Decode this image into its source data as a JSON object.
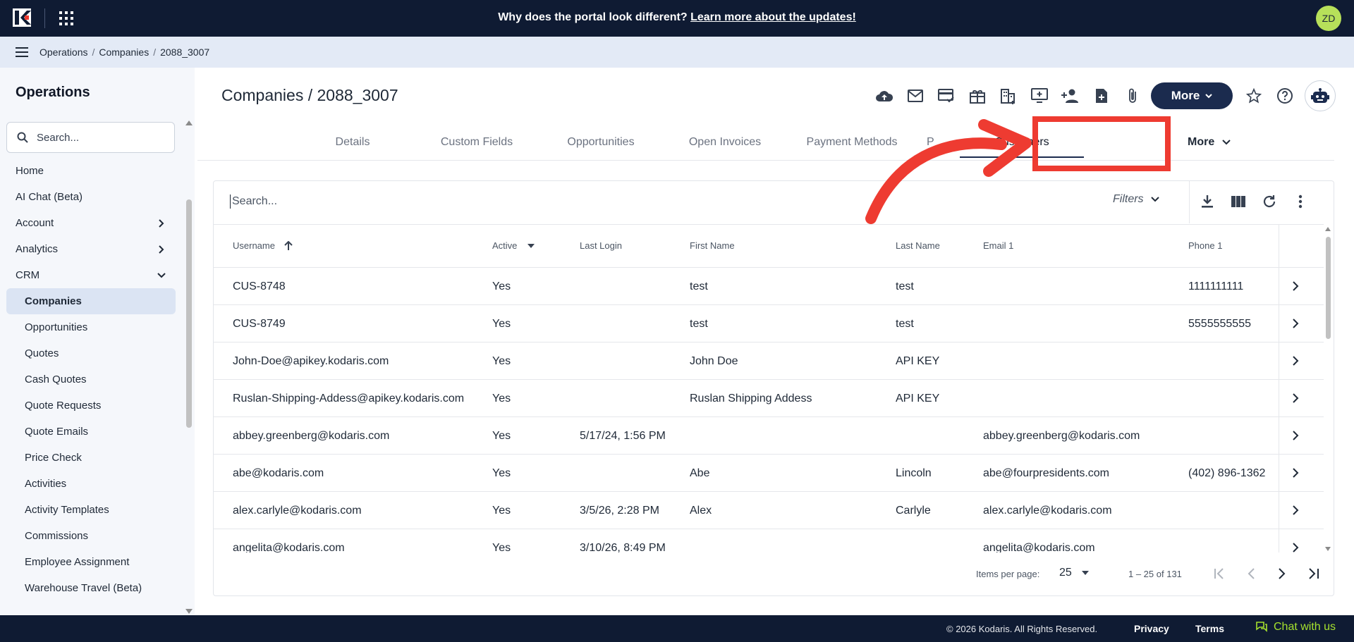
{
  "banner": {
    "text": "Why does the portal look different? ",
    "link": "Learn more about the updates!"
  },
  "user": {
    "initials": "ZD"
  },
  "breadcrumb": [
    "Operations",
    "Companies",
    "2088_3007"
  ],
  "sidebar": {
    "title": "Operations",
    "search_placeholder": "Search...",
    "items": [
      {
        "label": "Home",
        "type": "top"
      },
      {
        "label": "AI Chat (Beta)",
        "type": "top"
      },
      {
        "label": "Account",
        "type": "top",
        "chevron": "right"
      },
      {
        "label": "Analytics",
        "type": "top",
        "chevron": "right"
      },
      {
        "label": "CRM",
        "type": "top",
        "chevron": "down"
      },
      {
        "label": "Companies",
        "type": "sub",
        "active": true
      },
      {
        "label": "Opportunities",
        "type": "sub"
      },
      {
        "label": "Quotes",
        "type": "sub"
      },
      {
        "label": "Cash Quotes",
        "type": "sub"
      },
      {
        "label": "Quote Requests",
        "type": "sub"
      },
      {
        "label": "Quote Emails",
        "type": "sub"
      },
      {
        "label": "Price Check",
        "type": "sub"
      },
      {
        "label": "Activities",
        "type": "sub"
      },
      {
        "label": "Activity Templates",
        "type": "sub"
      },
      {
        "label": "Commissions",
        "type": "sub"
      },
      {
        "label": "Employee Assignment",
        "type": "sub"
      },
      {
        "label": "Warehouse Travel (Beta)",
        "type": "sub"
      }
    ]
  },
  "page": {
    "title": "Companies / 2088_3007",
    "more_label": "More"
  },
  "action_icons": [
    "cloud-upload-icon",
    "mail-icon",
    "card-check-icon",
    "gift-icon",
    "building-icon",
    "monitor-add-icon",
    "person-add-icon",
    "doc-add-icon",
    "paperclip-icon"
  ],
  "tabs": [
    {
      "label": "Details",
      "w": 0
    },
    {
      "label": "Custom Fields"
    },
    {
      "label": "Opportunities"
    },
    {
      "label": "Open Invoices"
    },
    {
      "label": "Payment Methods"
    },
    {
      "label": "P"
    },
    {
      "label": "Customers",
      "active": true
    }
  ],
  "tab_more": "More",
  "table": {
    "search_placeholder": "Search...",
    "filters_label": "Filters",
    "columns": [
      {
        "label": "Username",
        "sort": "asc"
      },
      {
        "label": "Active",
        "sort": "filter"
      },
      {
        "label": "Last Login"
      },
      {
        "label": "First Name"
      },
      {
        "label": "Last Name"
      },
      {
        "label": "Email 1"
      },
      {
        "label": "Phone 1"
      }
    ],
    "rows": [
      [
        "CUS-8748",
        "Yes",
        "",
        "test",
        "test",
        "",
        "1111111111"
      ],
      [
        "CUS-8749",
        "Yes",
        "",
        "test",
        "test",
        "",
        "5555555555"
      ],
      [
        "John-Doe@apikey.kodaris.com",
        "Yes",
        "",
        "John Doe",
        "API KEY",
        "",
        ""
      ],
      [
        "Ruslan-Shipping-Addess@apikey.kodaris.com",
        "Yes",
        "",
        "Ruslan Shipping Addess",
        "API KEY",
        "",
        ""
      ],
      [
        "abbey.greenberg@kodaris.com",
        "Yes",
        "5/17/24, 1:56 PM",
        "",
        "",
        "abbey.greenberg@kodaris.com",
        ""
      ],
      [
        "abe@kodaris.com",
        "Yes",
        "",
        "Abe",
        "Lincoln",
        "abe@fourpresidents.com",
        "(402) 896-1362"
      ],
      [
        "alex.carlyle@kodaris.com",
        "Yes",
        "3/5/26, 2:28 PM",
        "Alex",
        "Carlyle",
        "alex.carlyle@kodaris.com",
        ""
      ],
      [
        "angelita@kodaris.com",
        "Yes",
        "3/10/26, 8:49 PM",
        "",
        "",
        "angelita@kodaris.com",
        ""
      ]
    ]
  },
  "pager": {
    "items_label": "Items per page:",
    "page_size": "25",
    "range": "1 – 25 of 131"
  },
  "footer": {
    "copyright": "© 2026 Kodaris. All Rights Reserved.",
    "privacy": "Privacy",
    "terms": "Terms",
    "chat": "Chat with us"
  },
  "colors": {
    "navy": "#0f1b33",
    "annotation_red": "#ee3b31",
    "chat_green": "#a6e22e",
    "avatar_green": "#b7e05a"
  }
}
